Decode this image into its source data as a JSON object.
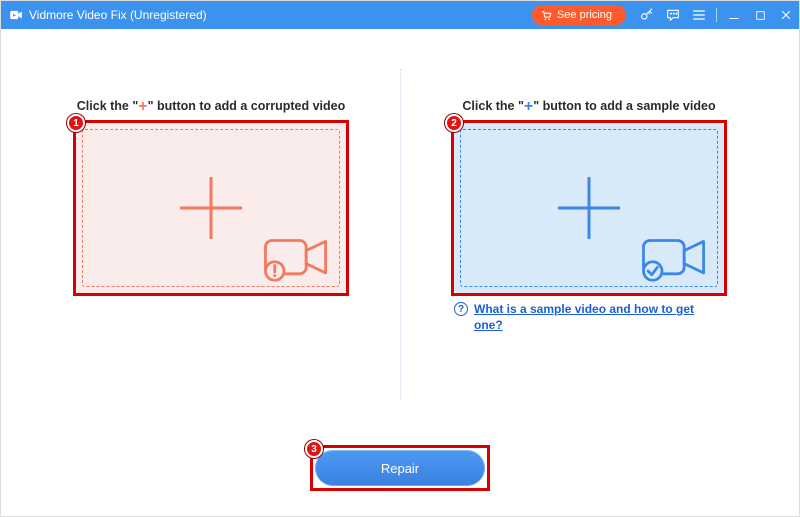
{
  "titlebar": {
    "app_name": "Vidmore Video Fix (Unregistered)",
    "pricing_label": "See pricing"
  },
  "panes": {
    "left": {
      "instruction_pre": "Click the \"",
      "instruction_post": "\" button to add a corrupted video",
      "plus_glyph": "+"
    },
    "right": {
      "instruction_pre": "Click the \"",
      "instruction_post": "\" button to add a sample video",
      "plus_glyph": "+"
    }
  },
  "help": {
    "text": "What is a sample video and how to get one?"
  },
  "footer": {
    "repair_label": "Repair"
  },
  "annotations": {
    "badge1": "1",
    "badge2": "2",
    "badge3": "3"
  }
}
